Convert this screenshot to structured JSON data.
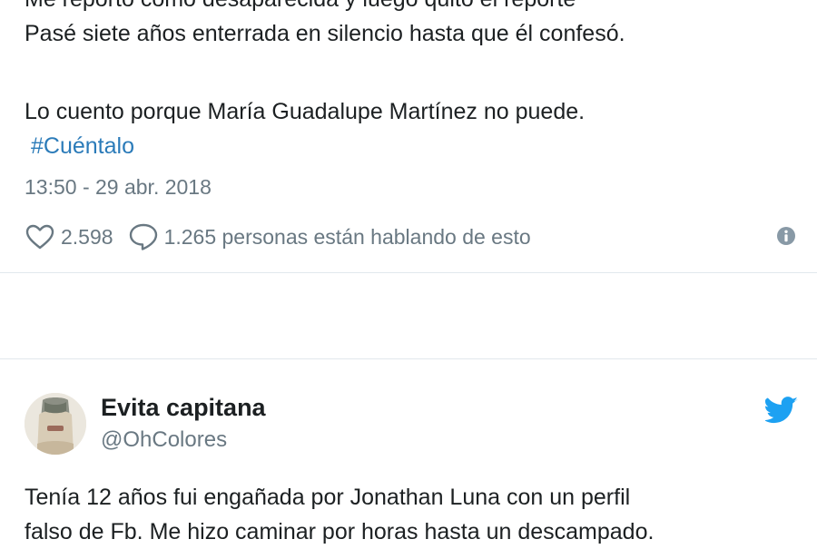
{
  "tweet1": {
    "lines": [
      "Me reportó como desaparecida y luego quitó el reporte",
      "Pasé siete años enterrada en silencio hasta que él confesó.",
      "Lo cuento porque María Guadalupe Martínez no puede."
    ],
    "hashtag": "#Cuéntalo",
    "timestamp": "13:50 - 29 abr. 2018",
    "likes": "2.598",
    "replies_text": "1.265 personas están hablando de esto",
    "icons": {
      "like": "heart-icon",
      "reply": "speech-bubble-icon",
      "info": "info-icon"
    }
  },
  "tweet2": {
    "author_name": "Evita capitana",
    "author_handle": "@OhColores",
    "lines": [
      "Tenía 12 años fui engañada por Jonathan Luna con un perfil",
      "falso de Fb. Me hizo caminar por horas hasta un descampado."
    ],
    "icons": {
      "brand": "twitter-bird-icon",
      "avatar": "avatar"
    }
  },
  "colors": {
    "text": "#1c2022",
    "secondary": "#697882",
    "hashtag": "#2b7bb9",
    "twitter_blue": "#1da1f2",
    "divider": "#e1e8ed"
  }
}
